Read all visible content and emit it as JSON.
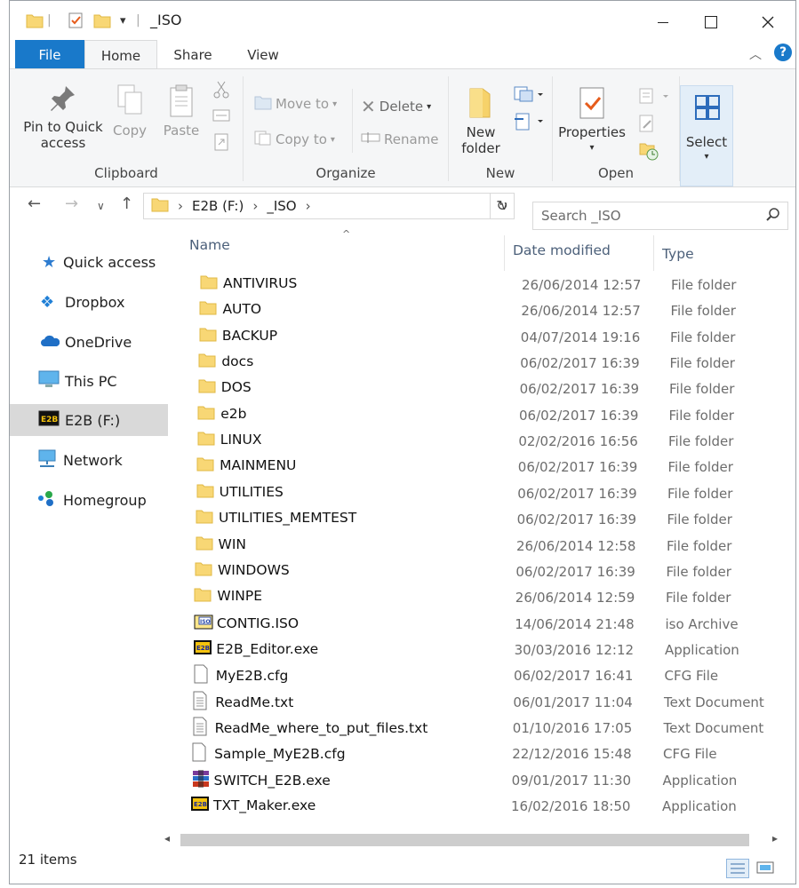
{
  "window": {
    "title": "_ISO",
    "minimize_icon": "minimize-icon",
    "maximize_icon": "maximize-icon",
    "close_icon": "close-icon"
  },
  "ribbon": {
    "tabs": [
      "File",
      "Home",
      "Share",
      "View"
    ],
    "groups": {
      "clipboard": {
        "label": "Clipboard",
        "pin_label": "Pin to Quick access",
        "copy_label": "Copy",
        "paste_label": "Paste"
      },
      "organize": {
        "label": "Organize",
        "move_to": "Move to",
        "copy_to": "Copy to",
        "delete": "Delete",
        "rename": "Rename"
      },
      "new": {
        "label": "New",
        "new_folder": "New folder"
      },
      "open": {
        "label": "Open",
        "properties": "Properties"
      },
      "select": {
        "label": "Select"
      }
    }
  },
  "address": {
    "crumbs": [
      "E2B (F:)",
      "_ISO"
    ],
    "search_placeholder": "Search _ISO"
  },
  "nav_pane": {
    "items": [
      {
        "label": "Quick access",
        "icon": "star-icon"
      },
      {
        "label": "Dropbox",
        "icon": "dropbox-icon"
      },
      {
        "label": "OneDrive",
        "icon": "cloud-icon"
      },
      {
        "label": "This PC",
        "icon": "monitor-icon"
      },
      {
        "label": "E2B (F:)",
        "icon": "drive-icon"
      },
      {
        "label": "Network",
        "icon": "network-icon"
      },
      {
        "label": "Homegroup",
        "icon": "homegroup-icon"
      }
    ]
  },
  "columns": {
    "name": "Name",
    "date": "Date modified",
    "type": "Type"
  },
  "files": [
    {
      "name": "ANTIVIRUS",
      "date": "26/06/2014 12:57",
      "type": "File folder",
      "icon": "folder-icon"
    },
    {
      "name": "AUTO",
      "date": "26/06/2014 12:57",
      "type": "File folder",
      "icon": "folder-icon"
    },
    {
      "name": "BACKUP",
      "date": "04/07/2014 19:16",
      "type": "File folder",
      "icon": "folder-icon"
    },
    {
      "name": "docs",
      "date": "06/02/2017 16:39",
      "type": "File folder",
      "icon": "folder-icon"
    },
    {
      "name": "DOS",
      "date": "06/02/2017 16:39",
      "type": "File folder",
      "icon": "folder-icon"
    },
    {
      "name": "e2b",
      "date": "06/02/2017 16:39",
      "type": "File folder",
      "icon": "folder-icon"
    },
    {
      "name": "LINUX",
      "date": "02/02/2016 16:56",
      "type": "File folder",
      "icon": "folder-icon"
    },
    {
      "name": "MAINMENU",
      "date": "06/02/2017 16:39",
      "type": "File folder",
      "icon": "folder-icon"
    },
    {
      "name": "UTILITIES",
      "date": "06/02/2017 16:39",
      "type": "File folder",
      "icon": "folder-icon"
    },
    {
      "name": "UTILITIES_MEMTEST",
      "date": "06/02/2017 16:39",
      "type": "File folder",
      "icon": "folder-icon"
    },
    {
      "name": "WIN",
      "date": "26/06/2014 12:58",
      "type": "File folder",
      "icon": "folder-icon"
    },
    {
      "name": "WINDOWS",
      "date": "06/02/2017 16:39",
      "type": "File folder",
      "icon": "folder-icon"
    },
    {
      "name": "WINPE",
      "date": "26/06/2014 12:59",
      "type": "File folder",
      "icon": "folder-icon"
    },
    {
      "name": "CONTIG.ISO",
      "date": "14/06/2014 21:48",
      "type": "iso Archive",
      "icon": "iso-icon"
    },
    {
      "name": "E2B_Editor.exe",
      "date": "30/03/2016 12:12",
      "type": "Application",
      "icon": "e2b-app-icon"
    },
    {
      "name": "MyE2B.cfg",
      "date": "06/02/2017 16:41",
      "type": "CFG File",
      "icon": "file-icon"
    },
    {
      "name": "ReadMe.txt",
      "date": "06/01/2017 11:04",
      "type": "Text Document",
      "icon": "text-file-icon"
    },
    {
      "name": "ReadMe_where_to_put_files.txt",
      "date": "01/10/2016 17:05",
      "type": "Text Document",
      "icon": "text-file-icon"
    },
    {
      "name": "Sample_MyE2B.cfg",
      "date": "22/12/2016 15:48",
      "type": "CFG File",
      "icon": "file-icon"
    },
    {
      "name": "SWITCH_E2B.exe",
      "date": "09/01/2017 11:30",
      "type": "Application",
      "icon": "archive-app-icon"
    },
    {
      "name": "TXT_Maker.exe",
      "date": "16/02/2016 18:50",
      "type": "Application",
      "icon": "e2b-app-icon"
    }
  ],
  "status": {
    "item_count": "21 items"
  }
}
